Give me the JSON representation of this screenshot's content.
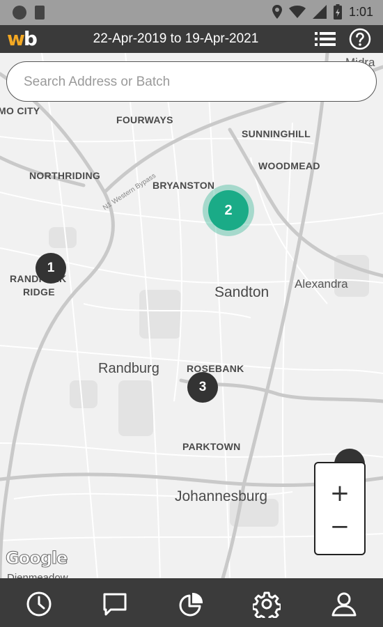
{
  "status_bar": {
    "time": "1:01"
  },
  "app_bar": {
    "logo": {
      "letter_w": "w",
      "letter_b": "b"
    },
    "date_range": "22-Apr-2019 to 19-Apr-2021",
    "icons": {
      "list": "list-icon",
      "help": "help-icon"
    }
  },
  "search": {
    "placeholder": "Search Address or Batch",
    "value": ""
  },
  "map": {
    "labels": {
      "city_partial": "MO CITY",
      "fourways": "FOURWAYS",
      "sunninghill": "SUNNINGHILL",
      "woodmead": "WOODMEAD",
      "northriding": "NORTHRIDING",
      "bryanston": "BRYANSTON",
      "n1_bypass": "N1 Western Bypass",
      "randpark": "RANDPARK",
      "ridge": "RIDGE",
      "sandton": "Sandton",
      "alexandra": "Alexandra",
      "randburg": "Randburg",
      "rosebank": "ROSEBANK",
      "parktown": "PARKTOWN",
      "johannesburg": "Johannesburg",
      "midrand_partial": "Midra",
      "dienmeadow_partial": "Dienmeadow"
    },
    "markers": [
      {
        "count": "2",
        "color": "#1aab87"
      },
      {
        "count": "1",
        "color": "#333333"
      },
      {
        "count": "3",
        "color": "#333333"
      }
    ],
    "zoom": {
      "in": "+",
      "out": "−"
    },
    "attribution": "Google"
  },
  "bottom_nav": [
    {
      "icon": "clock-icon"
    },
    {
      "icon": "chat-icon"
    },
    {
      "icon": "pie-chart-icon"
    },
    {
      "icon": "gear-icon"
    },
    {
      "icon": "user-icon"
    }
  ],
  "colors": {
    "accent": "#1aab87",
    "logo_orange": "#f3a823",
    "bar": "#3a3a3a"
  }
}
